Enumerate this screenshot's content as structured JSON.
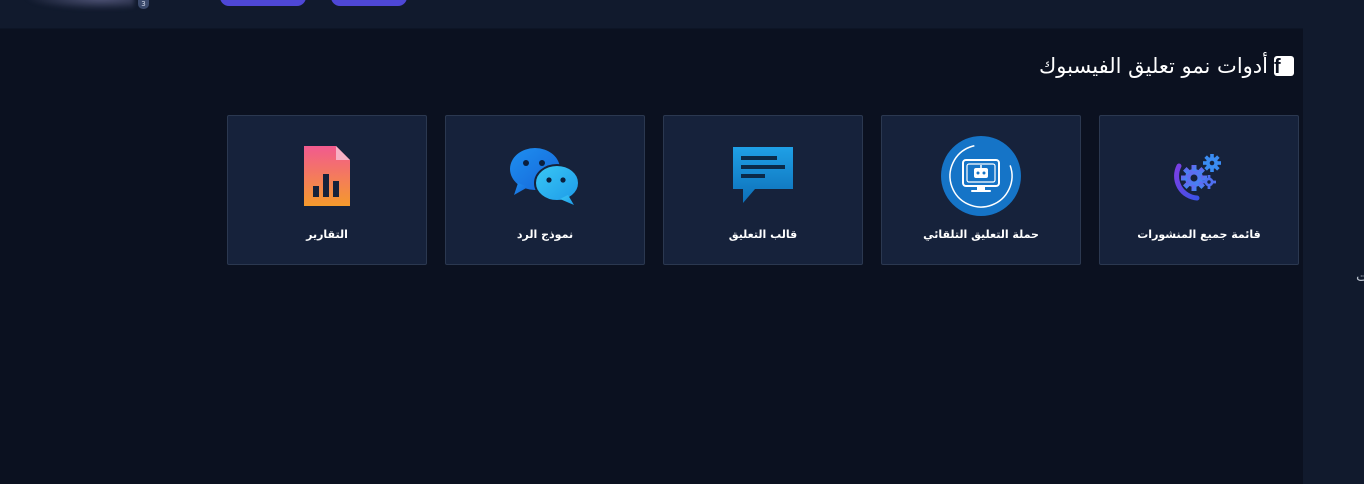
{
  "topbar": {
    "badge": "3"
  },
  "page": {
    "title": "أدوات نمو تعليق الفيسبوك",
    "title_icon": "facebook-icon"
  },
  "cards": [
    {
      "label": "قائمة جميع المنشورات",
      "icon": "gears-icon"
    },
    {
      "label": "حملة التعليق التلقائي",
      "icon": "robot-icon"
    },
    {
      "label": "قالب التعليق",
      "icon": "comment-template-icon"
    },
    {
      "label": "نموذج الرد",
      "icon": "chat-bubbles-icon"
    },
    {
      "label": "التقارير",
      "icon": "report-icon"
    }
  ],
  "side_panel": {
    "text": "ت"
  },
  "colors": {
    "background": "#0b1120",
    "card": "#16223b",
    "card_border": "#2b3850",
    "topbar": "#111a2d",
    "accent_pill": "#4e47d6"
  }
}
